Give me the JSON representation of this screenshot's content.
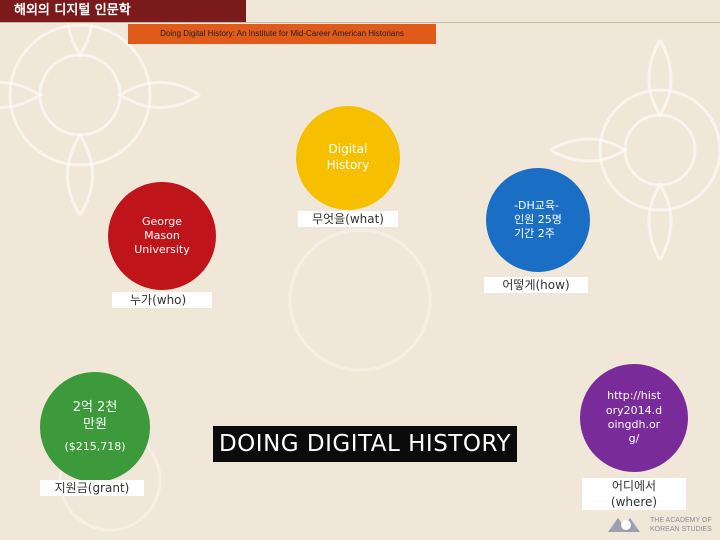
{
  "header": {
    "title": "해외의 디지털 인문학",
    "subtitle": "Doing Digital History: An Institute for Mid-Career American Historians"
  },
  "circles": {
    "organization": "George Mason University",
    "topic": "Digital History",
    "method": "-DH교육-\n인원 25명\n기간 2주",
    "grant": "2억 2천\n만원",
    "grant_usd": "($215,718)",
    "url": "http://hist\nory2014.d\noingdh.or\ng/"
  },
  "labels": {
    "who": "누가(who)",
    "what": "무엇을(what)",
    "how": "어떻게(how)",
    "grant": "지원금(grant)",
    "where": "어디에서\n(where)"
  },
  "logo": {
    "text": "DOING DIGITAL HISTORY"
  },
  "footer": {
    "academy_name": "THE ACADEMY OF\nKOREAN STUDIES"
  },
  "colors": {
    "header_bg": "#7a1a1a",
    "subtitle_bg": "#e05a1a",
    "red": "#c0141b",
    "yellow": "#f6c000",
    "blue": "#1a6fc4",
    "green": "#3d9a3a",
    "purple": "#7a2b9a"
  }
}
